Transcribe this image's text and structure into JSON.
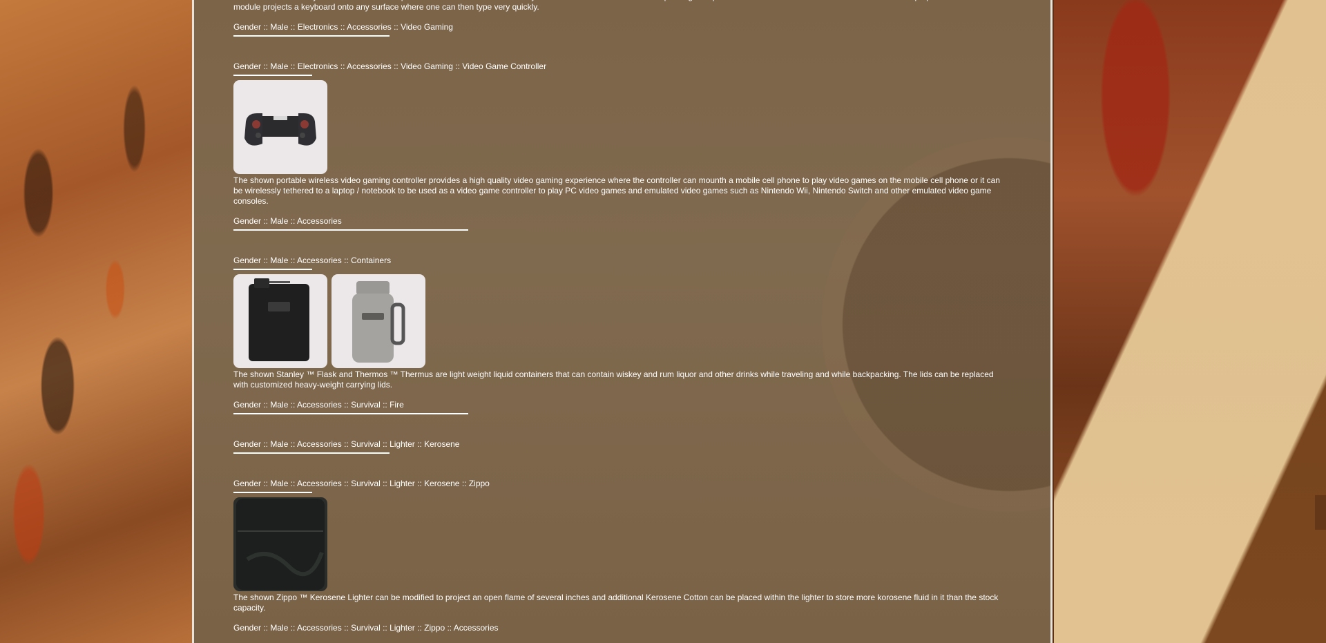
{
  "sections": [
    {
      "desc": "The AGS ™ Laser Keyboard module is a compact metal module that can be easily stored and removed from the backpacking backpack. It can be used with a Mobile Cell Phone and a Laptop / NoteBook. The module projects a keyboard onto any surface where one can then type very quickly.",
      "crumb": "Gender :: Male :: Electronics :: Accessories :: Video Gaming"
    },
    {
      "crumb": "Gender :: Male :: Electronics :: Accessories :: Video Gaming :: Video Game Controller",
      "images": [
        "game-controller-image"
      ],
      "desc": "The shown portable wireless video gaming controller provides a high quality video gaming experience where the controller can mounth a mobile cell phone to play video games on the mobile cell phone or it can be wirelessly tethered to a laptop / notebook to be used as a video game controller to play PC video games and emulated video games such as Nintendo Wii, Nintendo Switch and other emulated video game consoles."
    },
    {
      "crumb": "Gender :: Male :: Accessories"
    },
    {
      "crumb": "Gender :: Male :: Accessories :: Containers",
      "images": [
        "flask-image",
        "thermos-image"
      ],
      "desc": "The shown Stanley ™ Flask and Thermos ™ Thermus are light weight liquid containers that can contain wiskey and rum liquor and other drinks while traveling and while backpacking. The lids can be replaced with customized heavy-weight carrying lids."
    },
    {
      "crumb": "Gender :: Male :: Accessories :: Survival :: Fire"
    },
    {
      "crumb": "Gender :: Male :: Accessories :: Survival :: Lighter :: Kerosene"
    },
    {
      "crumb": "Gender :: Male :: Accessories :: Survival :: Lighter :: Kerosene :: Zippo",
      "images": [
        "zippo-lighter-image"
      ],
      "desc": "The shown Zippo ™ Kerosene Lighter can be modified to project an open flame of several inches and additional Kerosene Cotton can be placed within the lighter to store more korosene fluid in it than the stock capacity."
    },
    {
      "crumb": "Gender :: Male :: Accessories :: Survival :: Lighter :: Zippo :: Accessories"
    }
  ],
  "colors": {
    "panel": "#7c6448",
    "text": "#ffffff",
    "thumb_bg": "#ece8e9"
  }
}
